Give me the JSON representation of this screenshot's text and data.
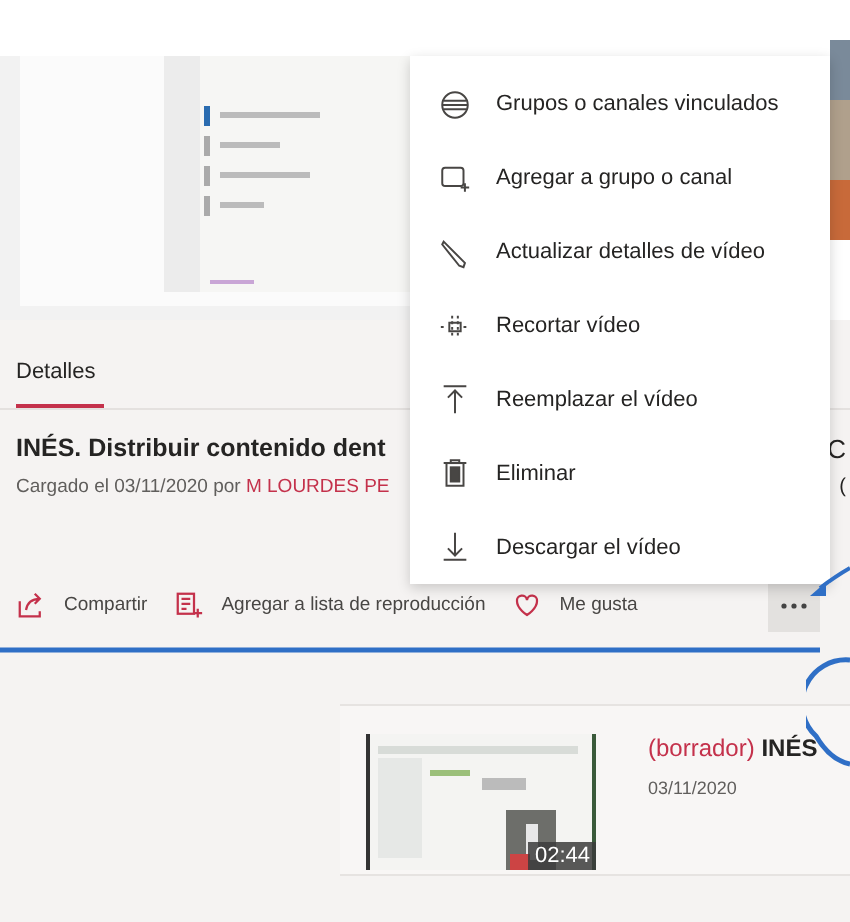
{
  "tabs": [
    {
      "label": "Detalles",
      "selected": true
    }
  ],
  "video": {
    "title": "INÉS. Distribuir contenido dent",
    "title_tail": "C",
    "uploaded_prefix": "Cargado el 03/11/2020 por",
    "author": "M LOURDES PE",
    "meta_tail": "("
  },
  "actions": [
    {
      "kind": "share",
      "label": "Compartir"
    },
    {
      "kind": "playlist",
      "label": "Agregar a lista de reproducción"
    },
    {
      "kind": "like",
      "label": "Me gusta"
    }
  ],
  "more_button": {
    "selected": true
  },
  "menu": [
    {
      "kind": "linked",
      "label": "Grupos o canales vinculados"
    },
    {
      "kind": "add",
      "label": "Agregar a grupo o canal"
    },
    {
      "kind": "edit",
      "label": "Actualizar detalles de vídeo"
    },
    {
      "kind": "trim",
      "label": "Recortar vídeo"
    },
    {
      "kind": "replace",
      "label": "Reemplazar el vídeo"
    },
    {
      "kind": "delete",
      "label": "Eliminar"
    },
    {
      "kind": "download",
      "label": "Descargar el vídeo"
    }
  ],
  "related": {
    "draft_tag": "(borrador)",
    "title": "INÉS",
    "date": "03/11/2020",
    "duration": "02:44"
  }
}
